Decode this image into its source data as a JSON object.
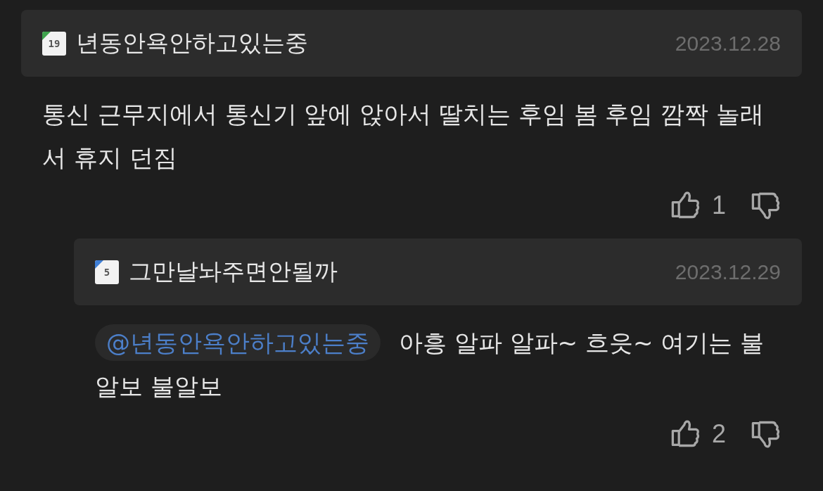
{
  "comments": [
    {
      "level": "19",
      "color": "#3fa34d",
      "author": "년동안욕안하고있는중",
      "date": "2023.12.28",
      "body": "통신 근무지에서 통신기 앞에 앉아서 딸치는 후임 봄 후임 깜짝 놀래서 휴지 던짐",
      "likes": "1",
      "reply": false
    },
    {
      "level": "5",
      "color": "#3f7fd6",
      "author": "그만날놔주면안될까",
      "date": "2023.12.29",
      "mention": "@년동안욕안하고있는중",
      "body": "아흥 알파 알파~ 흐읏~ 여기는 불알보 불알보",
      "likes": "2",
      "reply": true
    }
  ]
}
